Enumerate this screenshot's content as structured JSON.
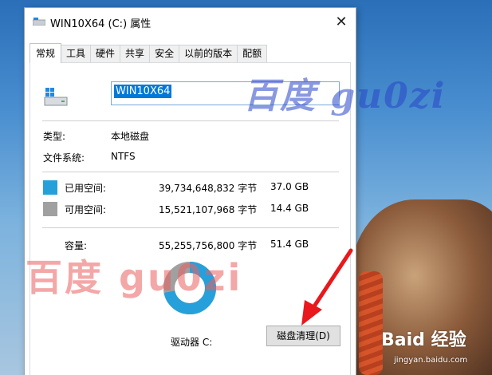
{
  "window": {
    "title": "WIN10X64 (C:) 属性",
    "close_glyph": "✕"
  },
  "tabs": [
    {
      "label": "常规",
      "active": true
    },
    {
      "label": "工具",
      "active": false
    },
    {
      "label": "硬件",
      "active": false
    },
    {
      "label": "共享",
      "active": false
    },
    {
      "label": "安全",
      "active": false
    },
    {
      "label": "以前的版本",
      "active": false
    },
    {
      "label": "配额",
      "active": false
    }
  ],
  "general": {
    "drive_name_value": "WIN10X64",
    "type_label": "类型:",
    "type_value": "本地磁盘",
    "fs_label": "文件系统:",
    "fs_value": "NTFS",
    "used": {
      "label": "已用空间:",
      "bytes": "39,734,648,832 字节",
      "size": "37.0 GB",
      "color": "#26a0da"
    },
    "free": {
      "label": "可用空间:",
      "bytes": "15,521,107,968 字节",
      "size": "14.4 GB",
      "color": "#a0a0a0"
    },
    "capacity": {
      "label": "容量:",
      "bytes": "55,255,756,800 字节",
      "size": "51.4 GB"
    },
    "drive_label": "驱动器 C:",
    "clean_button": "磁盘清理(D)",
    "used_fraction": 0.72
  },
  "watermarks": {
    "top": "百度 gu0zi",
    "middle": "百度 gu0zi",
    "baidu_logo": "Baid 经验",
    "baidu_url": "jingyan.baidu.com"
  },
  "colors": {
    "accent": "#0078d7",
    "used_color": "#26a0da",
    "free_color": "#a0a0a0"
  }
}
